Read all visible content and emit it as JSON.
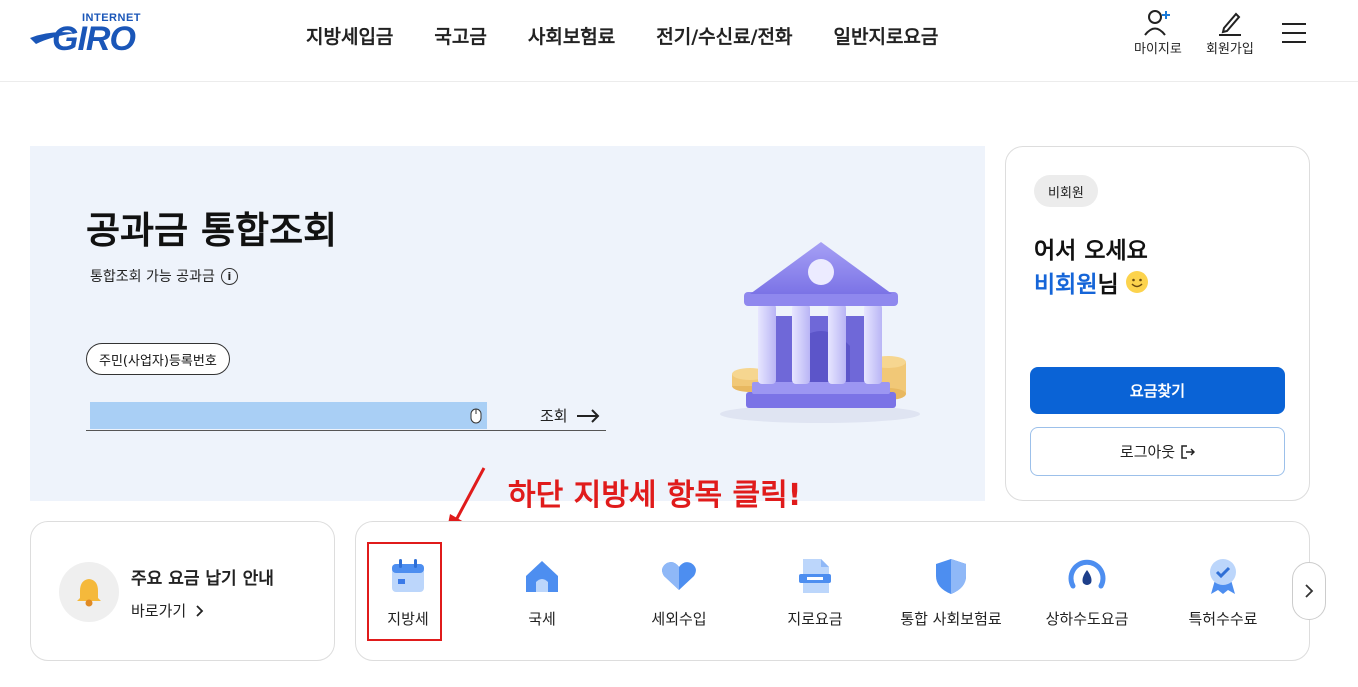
{
  "header": {
    "logo_small": "INTERNET",
    "logo_big": "GIRO",
    "nav": [
      {
        "label": "지방세입금"
      },
      {
        "label": "국고금"
      },
      {
        "label": "사회보험료"
      },
      {
        "label": "전기/수신료/전화"
      },
      {
        "label": "일반지로요금"
      }
    ],
    "mygiro_label": "마이지로",
    "signup_label": "회원가입",
    "menu_icon": "hamburger-icon"
  },
  "hero": {
    "title": "공과금 통합조회",
    "subtitle": "통합조회 가능 공과금",
    "id_chip": "주민(사업자)등록번호",
    "search_value": "",
    "search_button": "조회"
  },
  "panel": {
    "badge": "비회원",
    "greeting_line1": "어서 오세요",
    "greeting_name": "비회원",
    "greeting_suffix": "님",
    "primary_button": "요금찾기",
    "logout_button": "로그아웃"
  },
  "annotation": {
    "text": "하단 지방세 항목 클릭!",
    "color": "#e01b1b"
  },
  "notice": {
    "title": "주요 요금 납기 안내",
    "link": "바로가기"
  },
  "categories": [
    {
      "label": "지방세",
      "icon": "calendar-icon"
    },
    {
      "label": "국세",
      "icon": "house-icon"
    },
    {
      "label": "세외수입",
      "icon": "heart-icon"
    },
    {
      "label": "지로요금",
      "icon": "document-icon"
    },
    {
      "label": "통합 사회보험료",
      "icon": "shield-icon"
    },
    {
      "label": "상하수도요금",
      "icon": "water-gauge-icon"
    },
    {
      "label": "특허수수료",
      "icon": "award-icon"
    }
  ],
  "colors": {
    "brand": "#1a56b8",
    "primary_button": "#0a63d6",
    "hero_bg": "#eef3fb",
    "highlight": "#e01b1b"
  }
}
